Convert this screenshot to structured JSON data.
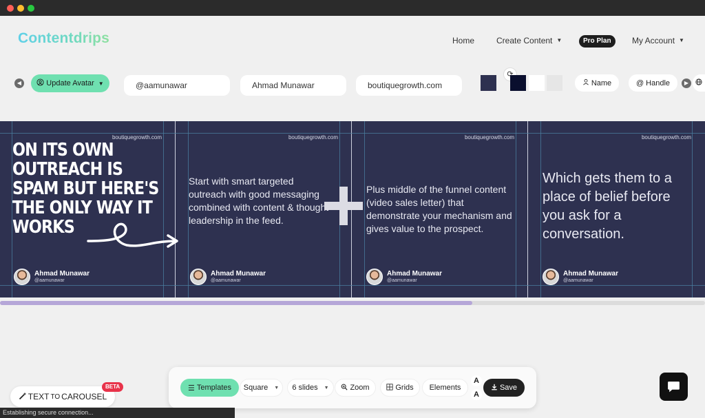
{
  "app": {
    "logo": "Contentdrips"
  },
  "nav": {
    "home": "Home",
    "create_content": "Create Content",
    "plan": "Pro Plan",
    "account": "My Account"
  },
  "controls": {
    "update_avatar": "Update Avatar",
    "handle": "@aamunawar",
    "name": "Ahmad Munawar",
    "website": "boutiquegrowth.com",
    "name_chip": "Name",
    "handle_chip": "Handle",
    "colors": [
      "#2e3150",
      "#0a0f2e",
      "#ffffff",
      "#e6e6e6"
    ]
  },
  "slides": [
    {
      "domain": "boutiquegrowth.com",
      "text": "On its own outreach is spam but here's the only way it works",
      "author": "Ahmad Munawar",
      "handle": "@aamunawar"
    },
    {
      "domain": "boutiquegrowth.com",
      "text": "Start with smart targeted outreach with good messaging combined with content & thought leadership in the feed.",
      "author": "Ahmad Munawar",
      "handle": "@aamunawar"
    },
    {
      "domain": "boutiquegrowth.com",
      "text": "Plus middle of the funnel content (video sales letter) that demonstrate your mechanism and gives value to the prospect.",
      "author": "Ahmad Munawar",
      "handle": "@aamunawar"
    },
    {
      "domain": "boutiquegrowth.com",
      "text": "Which gets them to a place of belief before you ask for a conversation.",
      "author": "Ahmad Munawar",
      "handle": "@aamunawar"
    }
  ],
  "scroll": {
    "position_fraction": 0.0,
    "visible_fraction": 0.67
  },
  "toolbar": {
    "templates": "Templates",
    "size": "Square",
    "slides": "6 slides",
    "zoom": "Zoom",
    "grids": "Grids",
    "elements": "Elements",
    "font_glyph": "A",
    "save": "Save"
  },
  "bottom": {
    "text_to": "TEXT",
    "to": "TO",
    "carousel": "CAROUSEL",
    "beta": "BETA",
    "status": "Establishing secure connection..."
  }
}
